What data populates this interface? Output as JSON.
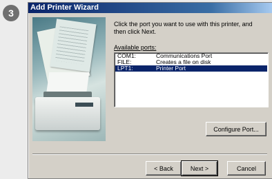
{
  "step_badge": "3",
  "window": {
    "title": "Add Printer Wizard"
  },
  "wizard": {
    "instructions": "Click the port you want to use with this printer, and then click Next.",
    "available_ports_label": "Available ports:",
    "ports": [
      {
        "port": "COM1:",
        "description": "Communications Port",
        "selected": false
      },
      {
        "port": "FILE:",
        "description": "Creates a file on disk",
        "selected": false
      },
      {
        "port": "LPT1:",
        "description": "Printer Port",
        "selected": true
      }
    ],
    "configure_button": "Configure Port...",
    "back_button": "< Back",
    "next_button": "Next >",
    "cancel_button": "Cancel"
  },
  "colors": {
    "title_bar": "#0a246a",
    "selection": "#0a246a",
    "dialog_face": "#d4d0c8"
  }
}
